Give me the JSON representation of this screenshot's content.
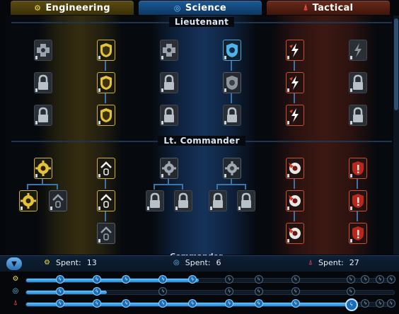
{
  "tabs": [
    {
      "label": "Engineering",
      "icon": "engineering-gear-icon",
      "color": "#f6d940"
    },
    {
      "label": "Science",
      "icon": "science-orb-icon",
      "color": "#6ec8ff"
    },
    {
      "label": "Tactical",
      "icon": "tactical-delta-icon",
      "color": "#ff4a4a"
    }
  ],
  "ranks": [
    "Lieutenant",
    "Lt. Commander",
    "Commander"
  ],
  "spent": [
    {
      "label": "Spent:",
      "value": "13"
    },
    {
      "label": "Spent:",
      "value": "6"
    },
    {
      "label": "Spent:",
      "value": "27"
    }
  ],
  "progress": [
    {
      "track": "engineering",
      "fraction": 0.47
    },
    {
      "track": "science",
      "fraction": 0.22
    },
    {
      "track": "tactical",
      "fraction": 0.88
    }
  ]
}
